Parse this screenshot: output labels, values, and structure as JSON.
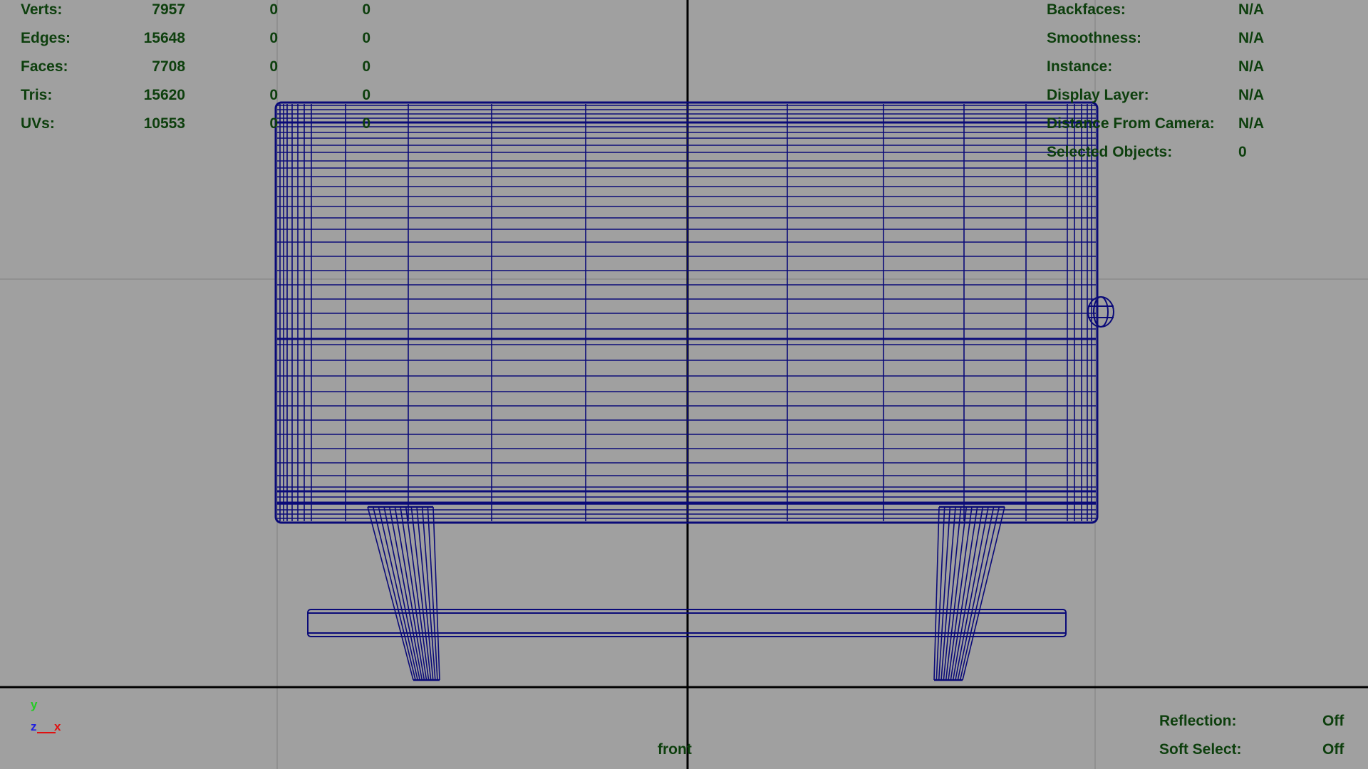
{
  "viewport": {
    "camera_name": "front",
    "background": "#a0a0a0",
    "wire_color": "#0a0a78",
    "grid_color": "#8a8a8a",
    "axis_color": "#000000"
  },
  "heads_up_left": {
    "rows": [
      {
        "label": "Verts:",
        "total": "7957",
        "selected": "0",
        "component": "0"
      },
      {
        "label": "Edges:",
        "total": "15648",
        "selected": "0",
        "component": "0"
      },
      {
        "label": "Faces:",
        "total": "7708",
        "selected": "0",
        "component": "0"
      },
      {
        "label": "Tris:",
        "total": "15620",
        "selected": "0",
        "component": "0"
      },
      {
        "label": "UVs:",
        "total": "10553",
        "selected": "0",
        "component": "0"
      }
    ]
  },
  "heads_up_right": {
    "rows": [
      {
        "label": "Backfaces:",
        "value": "N/A"
      },
      {
        "label": "Smoothness:",
        "value": "N/A"
      },
      {
        "label": "Instance:",
        "value": "N/A"
      },
      {
        "label": "Display Layer:",
        "value": "N/A"
      },
      {
        "label": "Distance From Camera:",
        "value": "N/A"
      },
      {
        "label": "Selected Objects:",
        "value": "0"
      }
    ]
  },
  "heads_up_bottom": {
    "rows": [
      {
        "label": "Reflection:",
        "value": "Off"
      },
      {
        "label": "Soft Select:",
        "value": "Off"
      }
    ]
  },
  "axis_gizmo": {
    "y": "y",
    "z": "z",
    "x": "x"
  },
  "hud_text_color": "#0d3f0d"
}
